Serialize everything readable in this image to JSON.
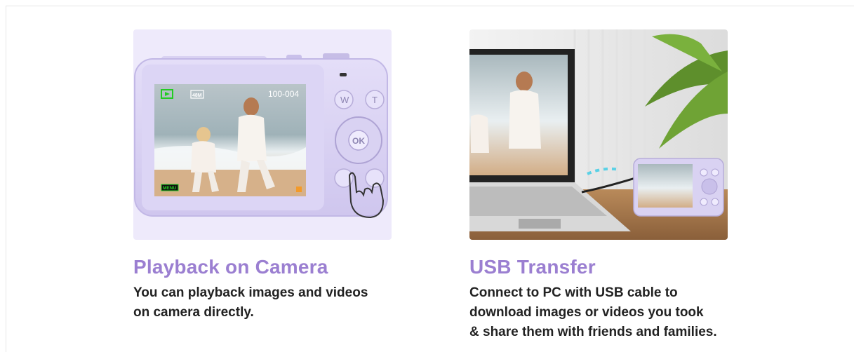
{
  "features": [
    {
      "title": "Playback on Camera",
      "description": "You can playback images and videos\non camera directly.",
      "image": {
        "screen_top_right": "100-004",
        "resolution_badge": "48M",
        "menu_label": "MENU",
        "buttons": [
          "W",
          "T",
          "OK"
        ]
      }
    },
    {
      "title": "USB Transfer",
      "description": "Connect to PC with USB cable to\ndownload images or videos you took\n& share them with friends and families."
    }
  ],
  "colors": {
    "title": "#9b7fd1",
    "body_text": "#222222",
    "camera_lilac": "#d9d2f2",
    "card_bg": "#eeeafb"
  }
}
